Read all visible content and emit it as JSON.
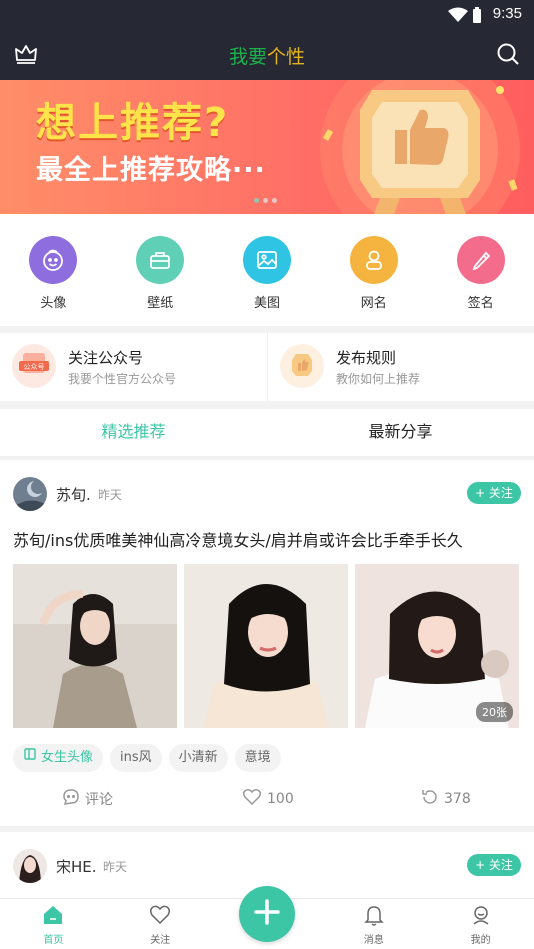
{
  "status_bar": {
    "time": "9:35"
  },
  "app_bar": {
    "title_part1": "我要",
    "title_part2": "个性",
    "icons": [
      "crown-icon",
      "search-icon"
    ]
  },
  "banner": {
    "headline": "想上推荐?",
    "subline": "最全上推荐攻略···",
    "slides": 3,
    "active_slide": 1
  },
  "categories": [
    {
      "label": "头像",
      "icon": "face-icon",
      "color": "#8e6ddf"
    },
    {
      "label": "壁纸",
      "icon": "briefcase-icon",
      "color": "#5fcfb6"
    },
    {
      "label": "美图",
      "icon": "image-icon",
      "color": "#2fc4e4"
    },
    {
      "label": "网名",
      "icon": "user-icon",
      "color": "#f5b43f"
    },
    {
      "label": "签名",
      "icon": "pen-icon",
      "color": "#f36c8c"
    }
  ],
  "promo": {
    "left": {
      "title": "关注公众号",
      "subtitle": "我要个性官方公众号",
      "badge": "公众号"
    },
    "right": {
      "title": "发布规则",
      "subtitle": "教你如何上推荐"
    }
  },
  "tabs": [
    "精选推荐",
    "最新分享"
  ],
  "active_tab": 0,
  "post": {
    "author": "苏旬.",
    "time": "昨天",
    "follow_label": "+ 关注",
    "title": "苏旬/ins优质唯美神仙高冷意境女头/肩并肩或许会比手牵手长久",
    "image_count": "20张",
    "tags": [
      "女生头像",
      "ins风",
      "小清新",
      "意境"
    ],
    "comment_label": "评论",
    "likes": "100",
    "shares": "378"
  },
  "post2": {
    "author": "宋HE.",
    "time": "昨天",
    "follow_label": "+ 关注"
  },
  "bottom_nav": [
    "首页",
    "关注",
    "",
    "消息",
    "我的"
  ],
  "accent_color": "#3cc6a6"
}
